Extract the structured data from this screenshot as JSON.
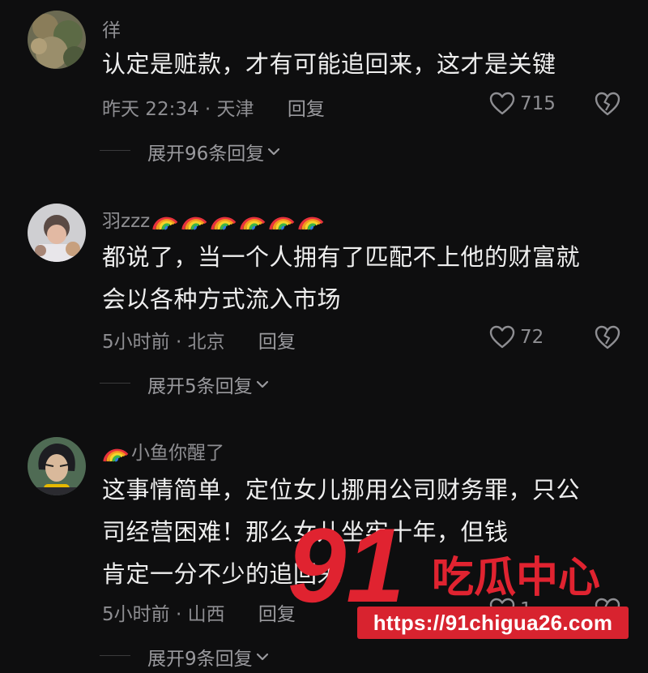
{
  "comments": [
    {
      "username": "徉",
      "rainbow_prefix": 0,
      "rainbow_suffix": 0,
      "lines": [
        "认定是赃款，才有可能追回来，这才是关键"
      ],
      "time_location": "昨天 22:34 · 天津",
      "reply_label": "回复",
      "likes": "715",
      "expand_label": "展开96条回复"
    },
    {
      "username": "羽zzz",
      "rainbow_prefix": 0,
      "rainbow_suffix": 6,
      "lines": [
        "都说了，当一个人拥有了匹配不上他的财富就",
        "会以各种方式流入市场"
      ],
      "time_location": "5小时前 · 北京",
      "reply_label": "回复",
      "likes": "72",
      "expand_label": "展开5条回复"
    },
    {
      "username": "小鱼你醒了",
      "rainbow_prefix": 1,
      "rainbow_suffix": 0,
      "lines": [
        "这事情简单，定位女儿挪用公司财务罪，只公",
        "司经营困难！那么女儿坐牢十年，但钱",
        "肯定一分不少的追回来"
      ],
      "time_location": "5小时前 · 山西",
      "reply_label": "回复",
      "likes": "1",
      "expand_label": "展开9条回复"
    }
  ],
  "watermark": {
    "number": "91",
    "brand": "吃瓜中心",
    "url": "https://91chigua26.com"
  },
  "colors": {
    "background": "#0e0e0f",
    "text": "#eeeeee",
    "secondary": "#8e8e92",
    "watermark_red": "#d8232f"
  },
  "icons": [
    "heart-icon",
    "broken-heart-icon",
    "chevron-down-icon",
    "rainbow-emoji"
  ]
}
